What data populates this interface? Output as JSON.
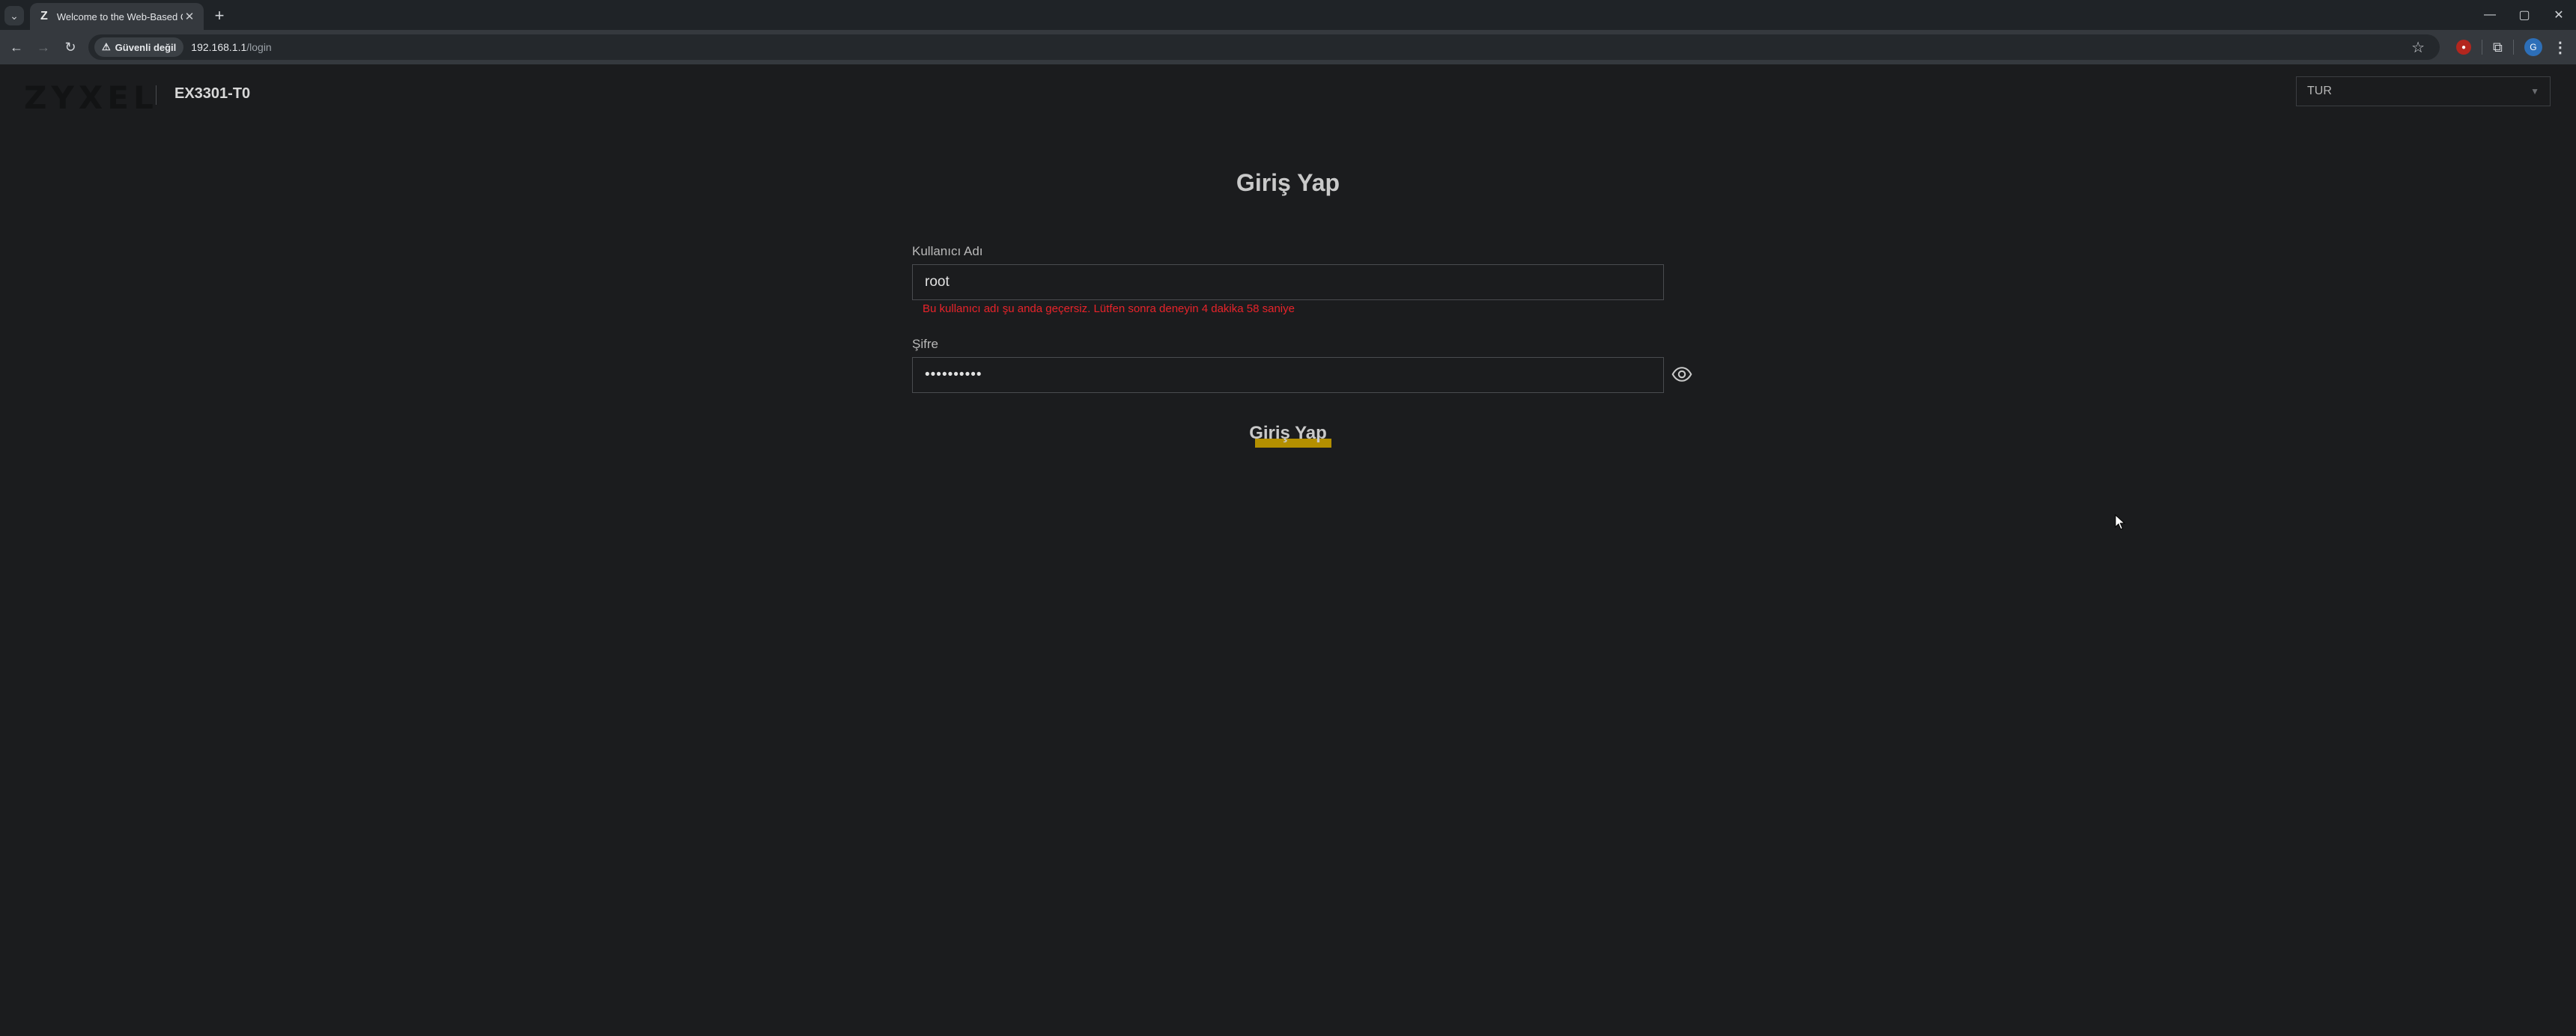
{
  "browser": {
    "tab": {
      "favicon": "Z",
      "title": "Welcome to the Web-Based Configurator",
      "close_icon": "✕"
    },
    "new_tab_icon": "+",
    "window_controls": {
      "minimize": "—",
      "maximize": "▢",
      "close": "✕"
    },
    "nav": {
      "back": "←",
      "forward": "→",
      "reload": "↻"
    },
    "security_chip": "Güvenli değil",
    "url_host": "192.168.1.1",
    "url_path": "/login",
    "profile_initial": "G"
  },
  "header": {
    "logo_text": "ZYXEL",
    "model": "EX3301-T0",
    "language_selected": "TUR"
  },
  "login": {
    "title": "Giriş Yap",
    "username_label": "Kullanıcı Adı",
    "username_value": "root",
    "error_message": "Bu kullanıcı adı şu anda geçersiz. Lütfen sonra deneyin 4 dakika 58 saniye",
    "password_label": "Şifre",
    "password_value": "••••••••••",
    "submit_label": "Giriş Yap"
  },
  "colors": {
    "page_background": "#1b1c1e",
    "error": "#e8232a",
    "button_accent": "#b38f00"
  }
}
